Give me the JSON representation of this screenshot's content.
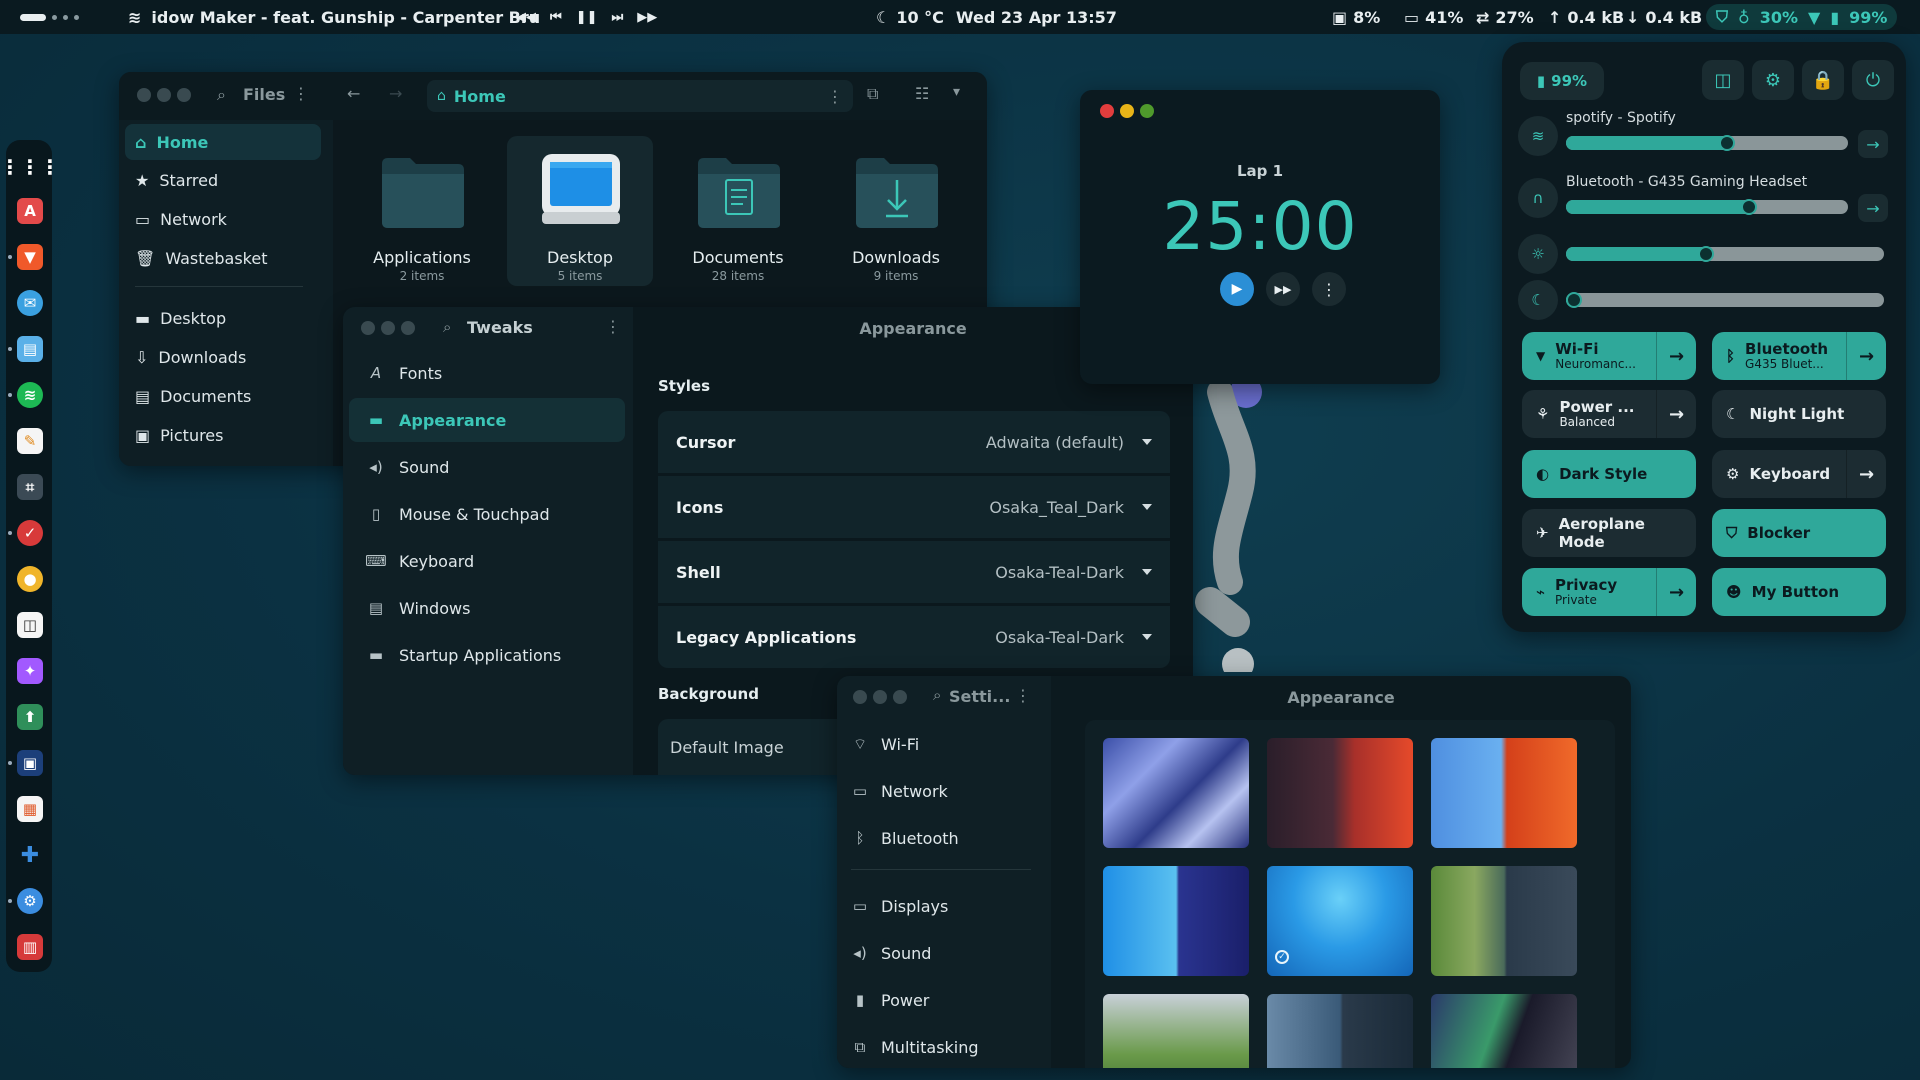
{
  "topbar": {
    "now_playing": "idow Maker - feat. Gunship - Carpenter Bru",
    "weather": "10 °C",
    "datetime": "Wed 23 Apr  13:57",
    "cpu": "8%",
    "battery_sys": "41%",
    "swap": "27%",
    "net_up": "0.4 kB",
    "net_down": "0.4 kB",
    "ram": "30%",
    "battery": "99%"
  },
  "files": {
    "title": "Files",
    "path": "Home",
    "sidebar": [
      "Home",
      "Starred",
      "Network",
      "Wastebasket",
      "Desktop",
      "Downloads",
      "Documents",
      "Pictures"
    ],
    "folders": [
      {
        "name": "Applications",
        "count": "2 items"
      },
      {
        "name": "Desktop",
        "count": "5 items"
      },
      {
        "name": "Documents",
        "count": "28 items"
      },
      {
        "name": "Downloads",
        "count": "9 items"
      }
    ]
  },
  "tweaks": {
    "title": "Tweaks",
    "page_title": "Appearance",
    "sidebar": [
      "Fonts",
      "Appearance",
      "Sound",
      "Mouse & Touchpad",
      "Keyboard",
      "Windows",
      "Startup Applications"
    ],
    "styles_heading": "Styles",
    "rows": [
      {
        "label": "Cursor",
        "value": "Adwaita (default)"
      },
      {
        "label": "Icons",
        "value": "Osaka_Teal_Dark"
      },
      {
        "label": "Shell",
        "value": "Osaka-Teal-Dark"
      },
      {
        "label": "Legacy Applications",
        "value": "Osaka-Teal-Dark"
      }
    ],
    "background_heading": "Background",
    "background_value": "Default Image"
  },
  "timer": {
    "lap": "Lap 1",
    "time": "25:00"
  },
  "settings": {
    "search_label": "Setti...",
    "page_title": "Appearance",
    "sidebar": [
      "Wi-Fi",
      "Network",
      "Bluetooth",
      "Displays",
      "Sound",
      "Power",
      "Multitasking"
    ]
  },
  "quick_settings": {
    "battery": "99%",
    "sliders": [
      {
        "label": "spotify - Spotify",
        "level": 0.57
      },
      {
        "label": "Bluetooth - G435 Gaming Headset",
        "level": 0.65
      },
      {
        "label": "",
        "level": 0.44
      },
      {
        "label": "",
        "level": 0.0
      }
    ],
    "toggles": [
      {
        "title": "Wi-Fi",
        "sub": "Neuromanc...",
        "on": true
      },
      {
        "title": "Bluetooth",
        "sub": "G435 Bluet...",
        "on": true
      },
      {
        "title": "Power ...",
        "sub": "Balanced",
        "on": false
      },
      {
        "title": "Night Light",
        "sub": "",
        "on": false
      },
      {
        "title": "Dark Style",
        "sub": "",
        "on": true
      },
      {
        "title": "Keyboard",
        "sub": "",
        "on": false
      },
      {
        "title": "Aeroplane Mode",
        "sub": "",
        "on": false
      },
      {
        "title": "Blocker",
        "sub": "",
        "on": true
      },
      {
        "title": "Privacy",
        "sub": "Private",
        "on": true
      },
      {
        "title": "My Button",
        "sub": "",
        "on": true
      }
    ]
  },
  "colors": {
    "accent": "#2fa89a",
    "accent_text": "#3cc7b8",
    "desktop": "#0c3545"
  }
}
